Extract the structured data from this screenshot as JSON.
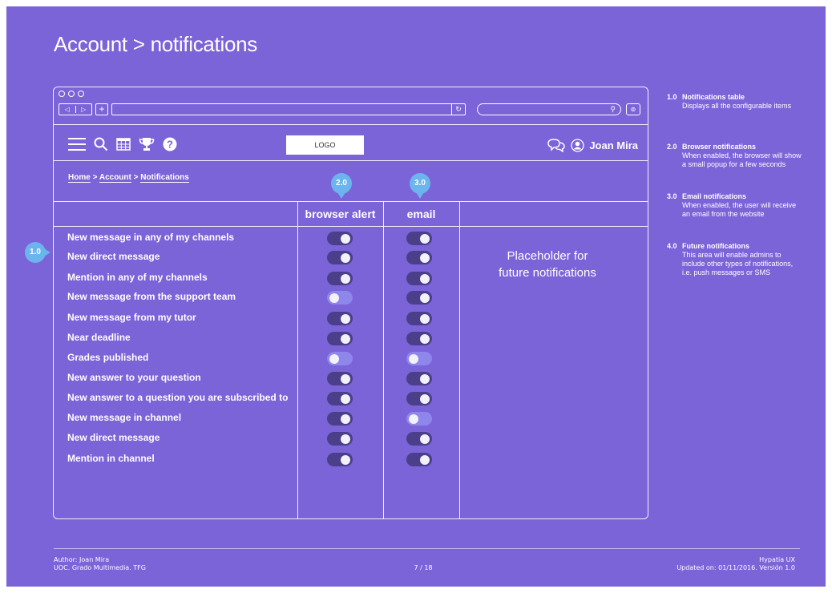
{
  "page_title": "Account > notifications",
  "browser": {
    "back": "◁",
    "forward": "▷",
    "new_tab": "+",
    "reload": "↻",
    "search_glyph": "⚲",
    "download_glyph": "⊚"
  },
  "app": {
    "logo": "LOGO",
    "user_name": "Joan Mira",
    "breadcrumb": {
      "home": "Home",
      "sep": ">",
      "account": "Account",
      "current": "Notifications"
    }
  },
  "columns": {
    "browser_alert": "browser alert",
    "email": "email"
  },
  "pins": {
    "table": "1.0",
    "browser": "2.0",
    "email": "3.0"
  },
  "rows": [
    {
      "label": "New message in any of my channels",
      "browser": true,
      "email": true
    },
    {
      "label": "New direct message",
      "browser": true,
      "email": true
    },
    {
      "label": "Mention in any of my channels",
      "browser": true,
      "email": true
    },
    {
      "label": "New message from the support team",
      "browser": false,
      "email": true
    },
    {
      "label": "New message from my tutor",
      "browser": true,
      "email": true
    },
    {
      "label": "Near deadline",
      "browser": true,
      "email": true
    },
    {
      "label": "Grades published",
      "browser": false,
      "email": false
    },
    {
      "label": "New answer to your question",
      "browser": true,
      "email": true
    },
    {
      "label": "New answer to a question you are subscribed to",
      "browser": true,
      "email": true
    },
    {
      "label": "New message in channel",
      "browser": true,
      "email": false
    },
    {
      "label": "New direct message",
      "browser": true,
      "email": true
    },
    {
      "label": "Mention in channel",
      "browser": true,
      "email": true
    }
  ],
  "placeholder": {
    "line1": "Placeholder for",
    "line2": "future notifications"
  },
  "notes": [
    {
      "num": "1.0",
      "head": "Notifications table",
      "lines": [
        "Displays all the configurable items"
      ]
    },
    {
      "num": "2.0",
      "head": "Browser notifications",
      "lines": [
        "When enabled, the browser will show",
        "a small popup for a few seconds"
      ]
    },
    {
      "num": "3.0",
      "head": "Email notifications",
      "lines": [
        "When enabled, the user will receive",
        "an email from the website"
      ]
    },
    {
      "num": "4.0",
      "head": "Future notifications",
      "lines": [
        "This area will enable admins to",
        "include other types of notifications,",
        "i.e. push messages or SMS"
      ]
    }
  ],
  "footer": {
    "author": "Author: Joan Mira",
    "org": "UOC. Grado Multimedia. TFG",
    "page": "7 / 18",
    "brand": "Hypatia UX",
    "updated": "Updated on: 01/11/2016. Versión 1.0"
  },
  "colors": {
    "background": "#7b63d8",
    "toggle_on": "#4b3f8a",
    "toggle_off": "#8f86ec",
    "pin": "#6cb4ee"
  }
}
